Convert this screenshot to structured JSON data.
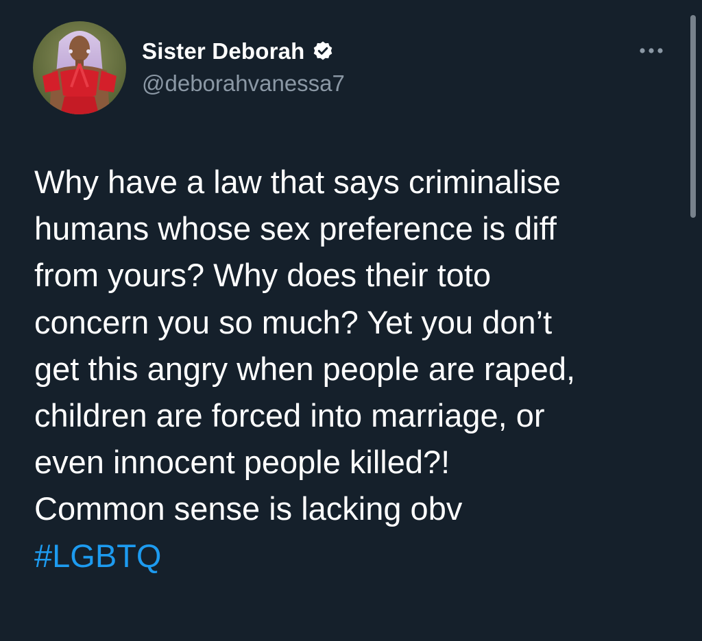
{
  "author": {
    "display_name": "Sister Deborah",
    "handle": "@deborahvanessa7",
    "verified": true
  },
  "tweet": {
    "lines": [
      "Why have a law that says criminalise",
      "humans whose sex preference is diff",
      "from yours? Why does their toto",
      "concern you so much? Yet you don’t",
      "get this angry when people are raped,",
      "children are forced into marriage, or",
      "even innocent people killed?!",
      "Common sense is lacking obv"
    ],
    "hashtag": "#LGBTQ"
  },
  "icons": {
    "verified": "verified-badge-icon",
    "more": "more-options-icon"
  },
  "colors": {
    "background": "#15202b",
    "text": "#ffffff",
    "secondary_text": "#8b98a5",
    "link": "#1d9bf0"
  }
}
